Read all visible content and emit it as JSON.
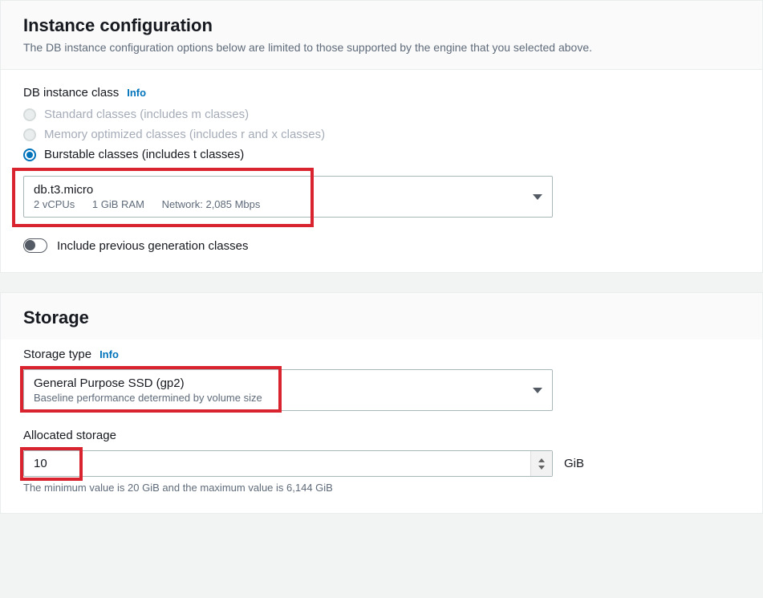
{
  "instance": {
    "title": "Instance configuration",
    "desc": "The DB instance configuration options below are limited to those supported by the engine that you selected above.",
    "class_label": "DB instance class",
    "info": "Info",
    "radios": {
      "standard": "Standard classes (includes m classes)",
      "memory": "Memory optimized classes (includes r and x classes)",
      "burstable": "Burstable classes (includes t classes)"
    },
    "select": {
      "main": "db.t3.micro",
      "vcpu": "2 vCPUs",
      "ram": "1 GiB RAM",
      "network": "Network: 2,085 Mbps"
    },
    "toggle_label": "Include previous generation classes"
  },
  "storage": {
    "title": "Storage",
    "type_label": "Storage type",
    "info": "Info",
    "select": {
      "main": "General Purpose SSD (gp2)",
      "sub": "Baseline performance determined by volume size"
    },
    "allocated_label": "Allocated storage",
    "allocated_value": "10",
    "unit": "GiB",
    "helper": "The minimum value is 20 GiB and the maximum value is 6,144 GiB"
  }
}
